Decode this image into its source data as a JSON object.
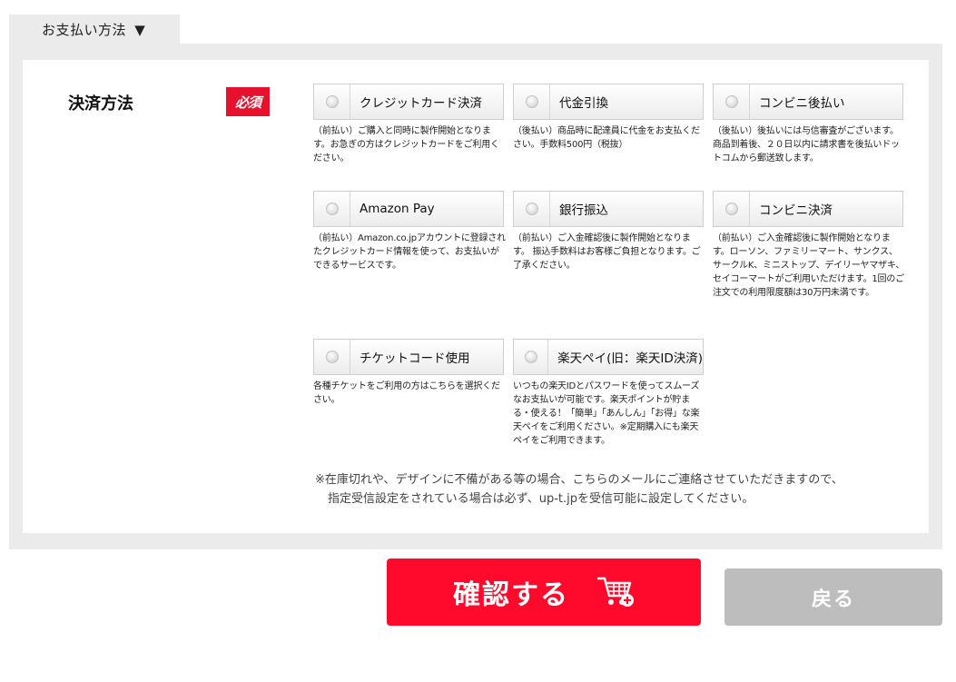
{
  "tab": {
    "label": "お支払い方法",
    "arrow": "▼"
  },
  "payment": {
    "field_label": "決済方法",
    "required_badge": "必須",
    "options": [
      {
        "label": "クレジットカード決済",
        "desc": "（前払い）ご購入と同時に製作開始となります。お急ぎの方はクレジットカードをご利用ください。"
      },
      {
        "label": "代金引換",
        "desc": "（後払い）商品時に配達員に代金をお支払ください。手数料500円（税抜）"
      },
      {
        "label": "コンビニ後払い",
        "desc": "（後払い）後払いには与信審査がございます。商品到着後、２０日以内に請求書を後払いドットコムから郵送致します。"
      },
      {
        "label": "Amazon Pay",
        "desc": "（前払い）Amazon.co.jpアカウントに登録されたクレジットカード情報を使って、お支払いができるサービスです。"
      },
      {
        "label": "銀行振込",
        "desc": "（前払い）ご入金確認後に製作開始となります。 振込手数料はお客様ご負担となります。ご了承ください。"
      },
      {
        "label": "コンビニ決済",
        "desc": "（前払い）ご入金確認後に製作開始となります。ローソン、ファミリーマート、サンクス、サークルK、ミニストップ、デイリーヤマザキ、セイコーマートがご利用いただけます。1回のご注文での利用限度額は30万円未満です。"
      },
      {
        "label": "チケットコード使用",
        "desc": "各種チケットをご利用の方はこちらを選択ください。"
      },
      {
        "label": "楽天ペイ(旧：楽天ID決済)",
        "desc": "いつもの楽天IDとパスワードを使ってスムーズなお支払いが可能です。楽天ポイントが貯まる・使える！「簡単」「あんしん」「お得」な楽天ペイをご利用ください。※定期購入にも楽天ペイをご利用できます。"
      }
    ],
    "note_line1": "※在庫切れや、デザインに不備がある等の場合、こちらのメールにご連絡させていただきますので、",
    "note_line2": "指定受信設定をされている場合は必ず、up-t.jpを受信可能に設定してください。"
  },
  "buttons": {
    "confirm_label": "確認する",
    "back_label": "戻る"
  },
  "icons": {
    "cart": "cart-plus-icon"
  },
  "colors": {
    "accent": "#ff0a2c",
    "badge": "#e8112d",
    "disabled": "#bdbdbd",
    "panel": "#ebebeb"
  }
}
